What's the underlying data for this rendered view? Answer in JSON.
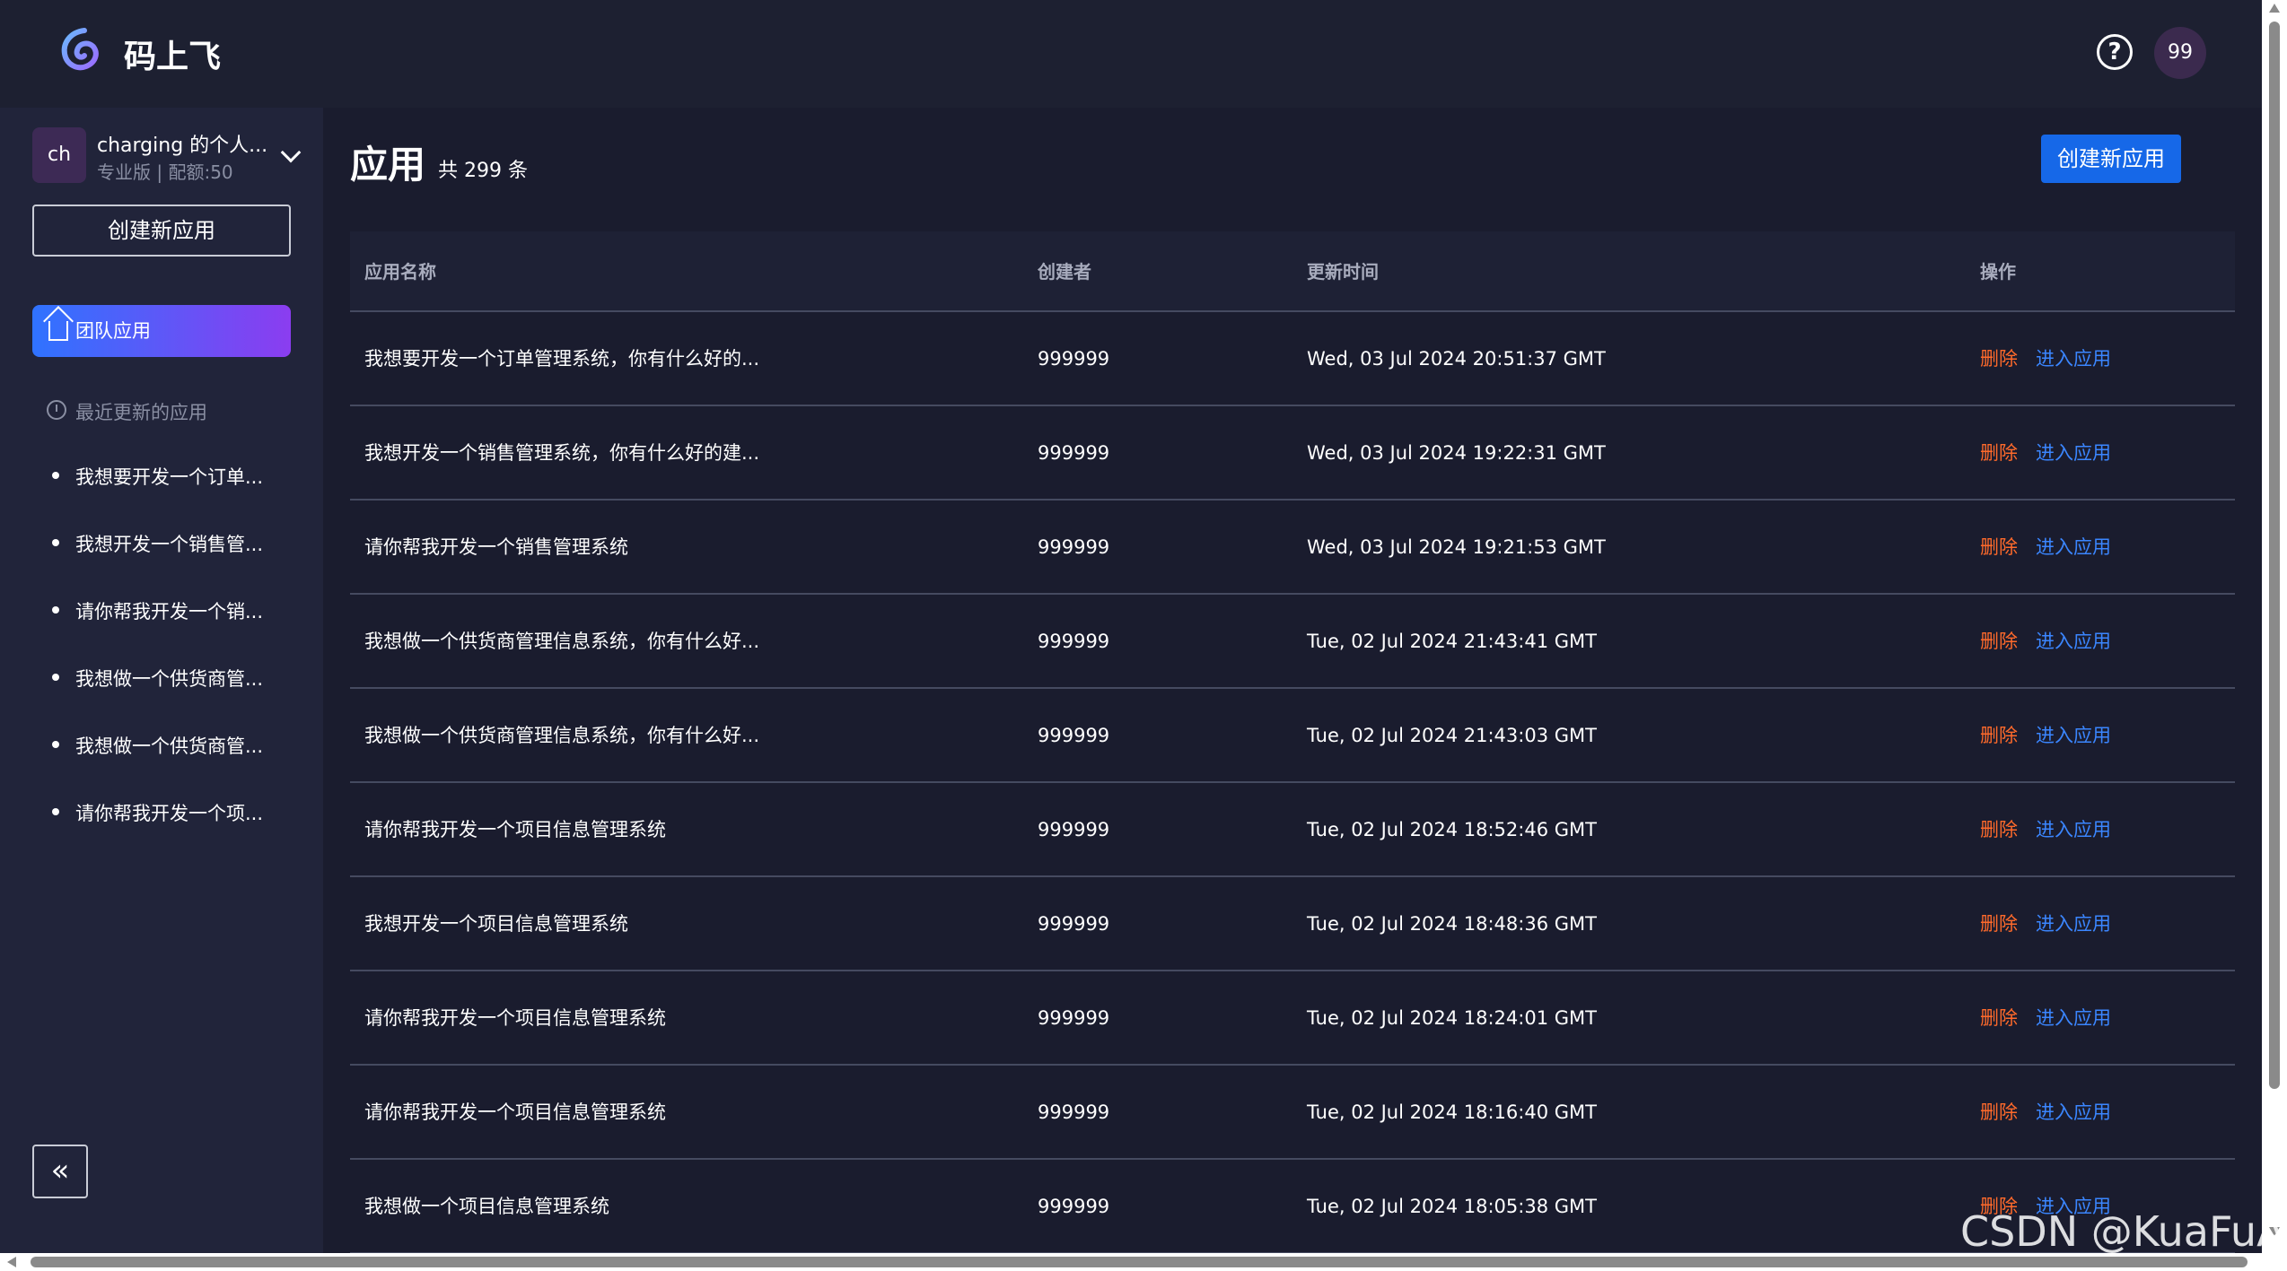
{
  "header": {
    "title": "码上飞",
    "user_avatar": "99"
  },
  "sidebar": {
    "workspace": {
      "avatar": "ch",
      "name": "charging 的个人...",
      "plan": "专业版 | 配额:50"
    },
    "create_label": "创建新应用",
    "nav_team_label": "团队应用",
    "recent_label": "最近更新的应用",
    "recent_items": [
      "我想要开发一个订单...",
      "我想开发一个销售管...",
      "请你帮我开发一个销...",
      "我想做一个供货商管...",
      "我想做一个供货商管...",
      "请你帮我开发一个项..."
    ],
    "collapse_glyph": "«"
  },
  "main": {
    "title": "应用",
    "count": "共 299 条",
    "create_label": "创建新应用",
    "table": {
      "headers": [
        "应用名称",
        "创建者",
        "更新时间",
        "操作"
      ],
      "delete_label": "删除",
      "enter_label": "进入应用",
      "rows": [
        {
          "name": "我想要开发一个订单管理系统，你有什么好的...",
          "creator": "999999",
          "time": "Wed, 03 Jul 2024 20:51:37 GMT"
        },
        {
          "name": "我想开发一个销售管理系统，你有什么好的建...",
          "creator": "999999",
          "time": "Wed, 03 Jul 2024 19:22:31 GMT"
        },
        {
          "name": "请你帮我开发一个销售管理系统",
          "creator": "999999",
          "time": "Wed, 03 Jul 2024 19:21:53 GMT"
        },
        {
          "name": "我想做一个供货商管理信息系统，你有什么好...",
          "creator": "999999",
          "time": "Tue, 02 Jul 2024 21:43:41 GMT"
        },
        {
          "name": "我想做一个供货商管理信息系统，你有什么好...",
          "creator": "999999",
          "time": "Tue, 02 Jul 2024 21:43:03 GMT"
        },
        {
          "name": "请你帮我开发一个项目信息管理系统",
          "creator": "999999",
          "time": "Tue, 02 Jul 2024 18:52:46 GMT"
        },
        {
          "name": "我想开发一个项目信息管理系统",
          "creator": "999999",
          "time": "Tue, 02 Jul 2024 18:48:36 GMT"
        },
        {
          "name": "请你帮我开发一个项目信息管理系统",
          "creator": "999999",
          "time": "Tue, 02 Jul 2024 18:24:01 GMT"
        },
        {
          "name": "请你帮我开发一个项目信息管理系统",
          "creator": "999999",
          "time": "Tue, 02 Jul 2024 18:16:40 GMT"
        },
        {
          "name": "我想做一个项目信息管理系统",
          "creator": "999999",
          "time": "Tue, 02 Jul 2024 18:05:38 GMT"
        }
      ]
    }
  },
  "watermark": "CSDN @KuaFuAI",
  "colors": {
    "accent": "#1668e8",
    "delete": "#ff6a2b",
    "link": "#3b86ff",
    "bg": "#1a1c2e"
  }
}
